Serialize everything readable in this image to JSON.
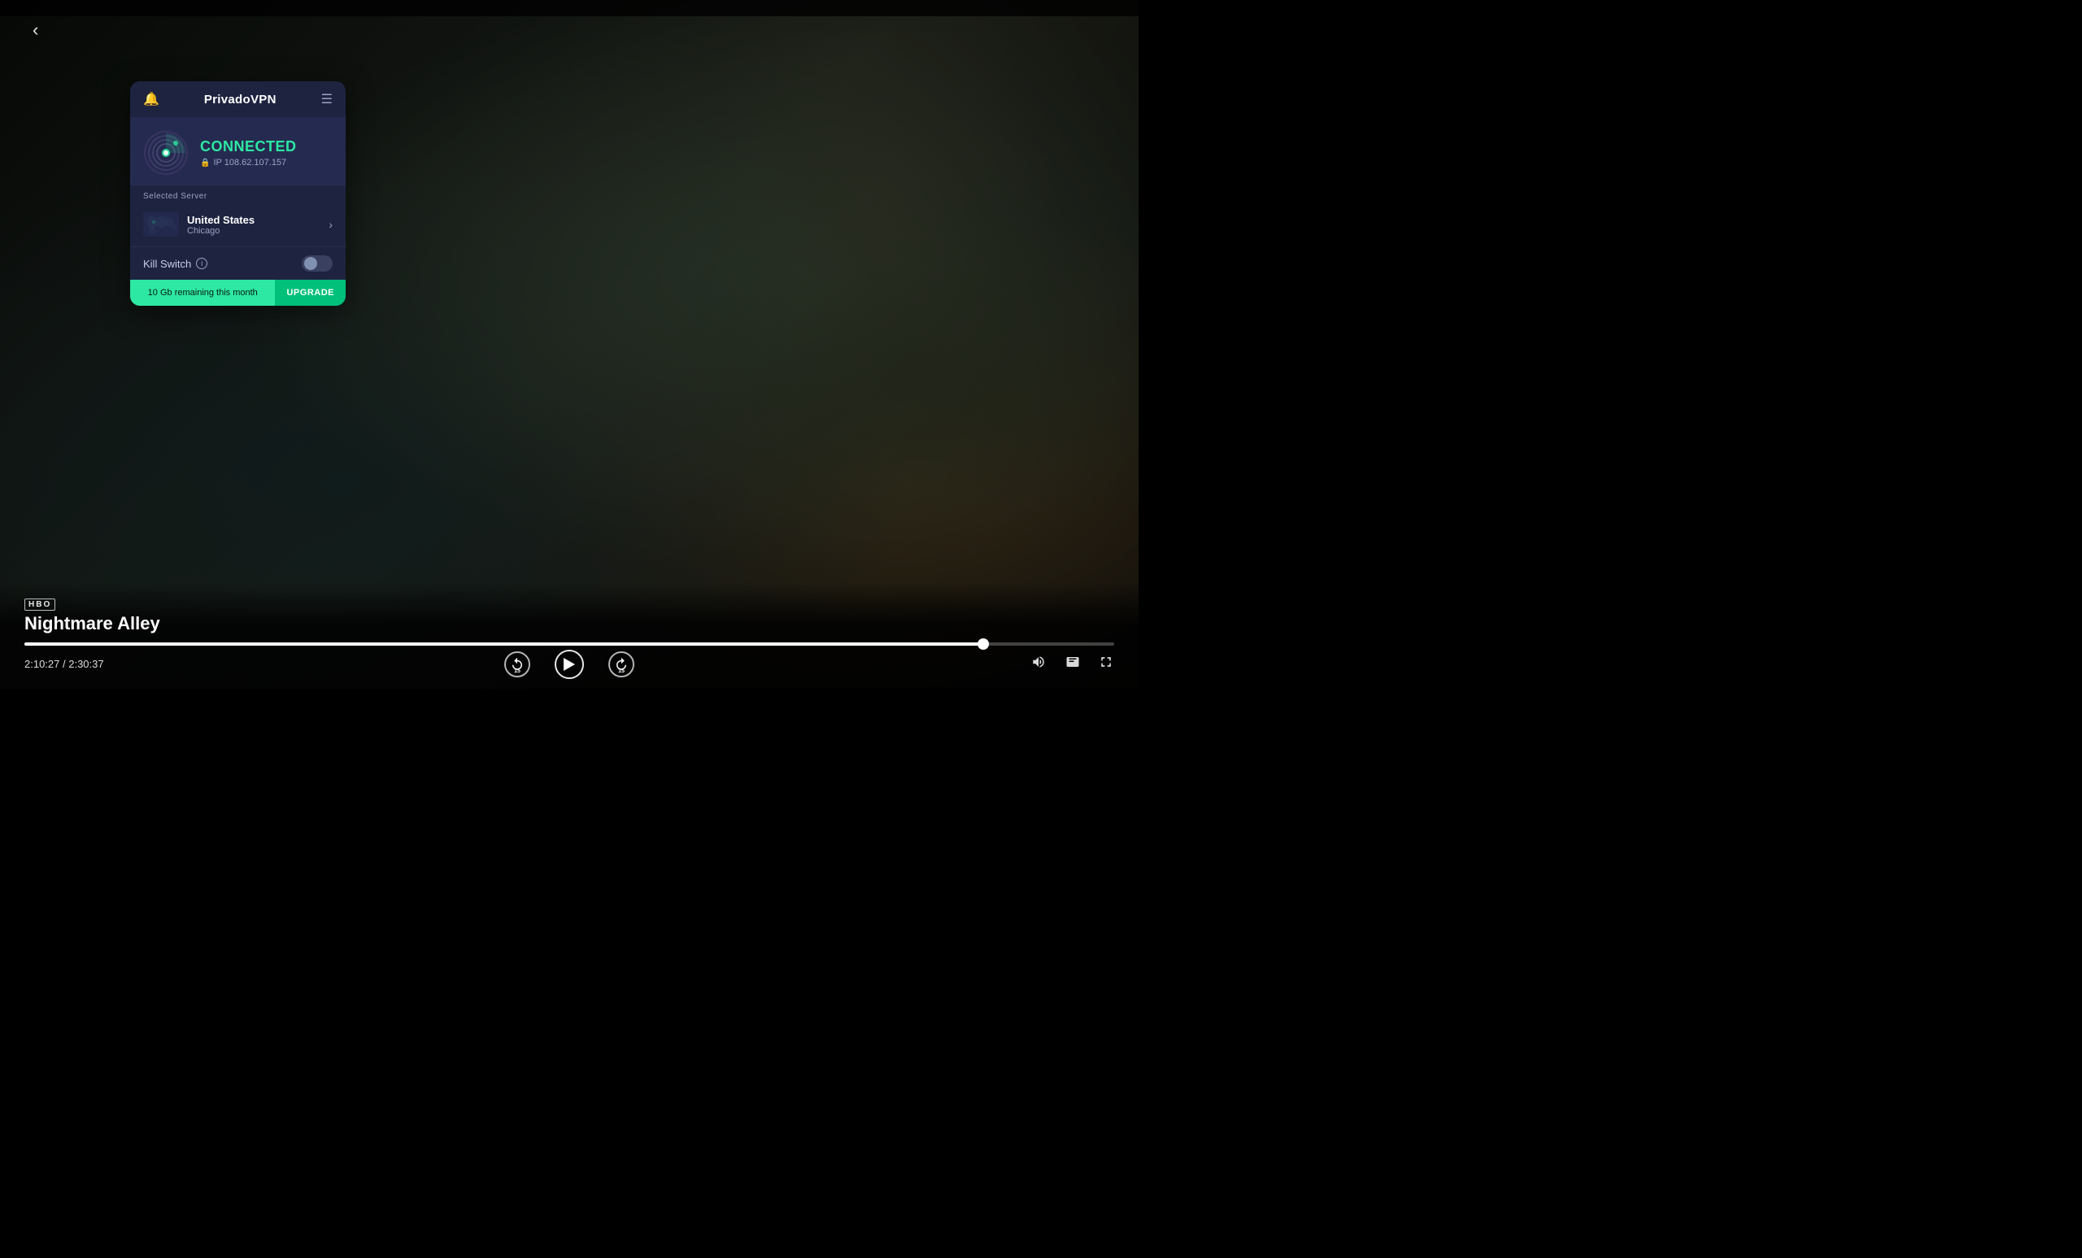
{
  "video": {
    "bg_color": "#0a0e0a",
    "title": "Nightmare Alley",
    "network": "HBO",
    "time_current": "2:10:27",
    "time_total": "2:30:37",
    "time_separator": "/",
    "progress_percent": 88
  },
  "controls": {
    "back_label": "‹",
    "rewind_label": "15",
    "play_label": "▶",
    "forward_label": "15"
  },
  "vpn": {
    "app_name": "PrivadoVPN",
    "status": "CONNECTED",
    "ip_label": "IP 108.62.107.157",
    "server_label": "Selected Server",
    "country": "United States",
    "city": "Chicago",
    "killswitch_label": "Kill Switch",
    "killswitch_enabled": false,
    "footer_text": "10 Gb remaining this month",
    "upgrade_label": "UPGRADE"
  },
  "icons": {
    "bell": "🔔",
    "menu": "☰",
    "lock": "🔒",
    "info": "i",
    "chevron_right": "›",
    "volume": "🔊",
    "subtitle": "⬜",
    "fullscreen": "⛶"
  }
}
